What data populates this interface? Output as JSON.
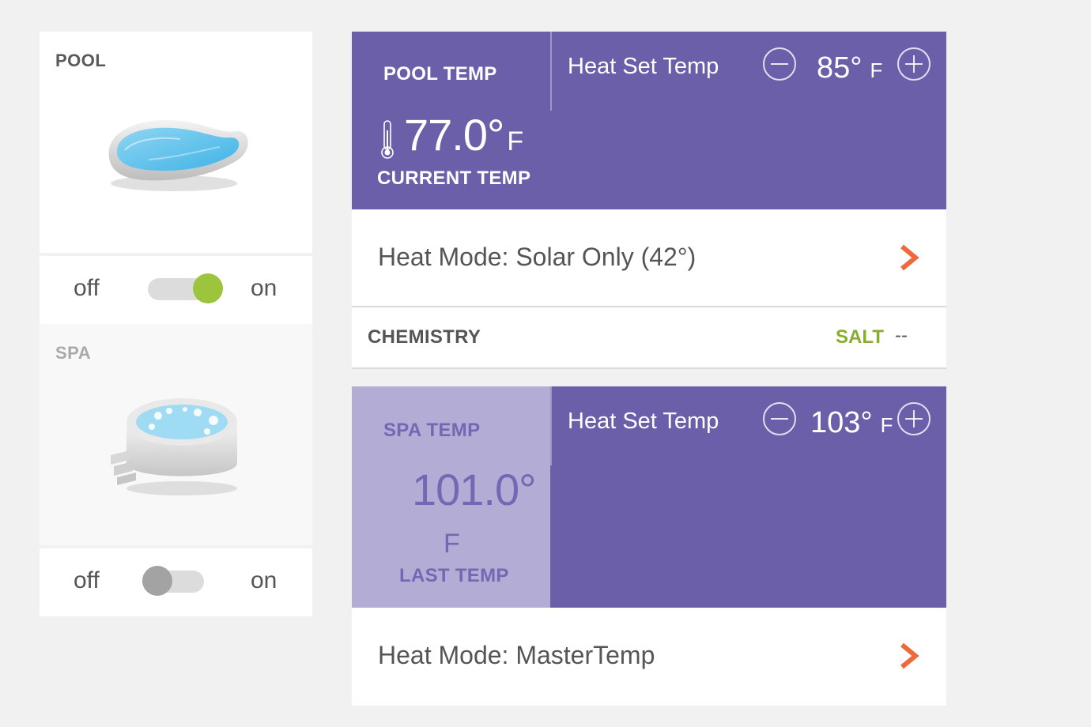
{
  "pool": {
    "title": "POOL",
    "toggle": {
      "off_label": "off",
      "on_label": "on",
      "state": "on"
    }
  },
  "spa": {
    "title": "SPA",
    "toggle": {
      "off_label": "off",
      "on_label": "on",
      "state": "off"
    }
  },
  "pool_temp": {
    "title": "POOL TEMP",
    "value": "77.0°",
    "unit": "F",
    "caption": "CURRENT TEMP",
    "heat_set_label": "Heat Set Temp",
    "set_value": "85°",
    "set_unit": "F",
    "heat_mode": "Heat Mode: Solar Only (42°)"
  },
  "chemistry": {
    "title": "CHEMISTRY",
    "salt_label": "SALT",
    "salt_value": "--"
  },
  "spa_temp": {
    "title": "SPA TEMP",
    "value": "101.0°",
    "unit": "F",
    "caption": "LAST TEMP",
    "heat_set_label": "Heat Set Temp",
    "set_value": "103°",
    "set_unit": "F",
    "heat_mode": "Heat Mode: MasterTemp"
  },
  "colors": {
    "panel_purple": "#6b5fa9",
    "spa_temp_lavender": "#b3add5",
    "toggle_on_green": "#9cc43c",
    "salt_green": "#86ad2b",
    "chevron_orange": "#ee6a3d"
  },
  "icons": [
    "pool-illustration",
    "spa-illustration",
    "thermometer-icon",
    "minus-icon",
    "plus-icon",
    "chevron-right-icon"
  ]
}
